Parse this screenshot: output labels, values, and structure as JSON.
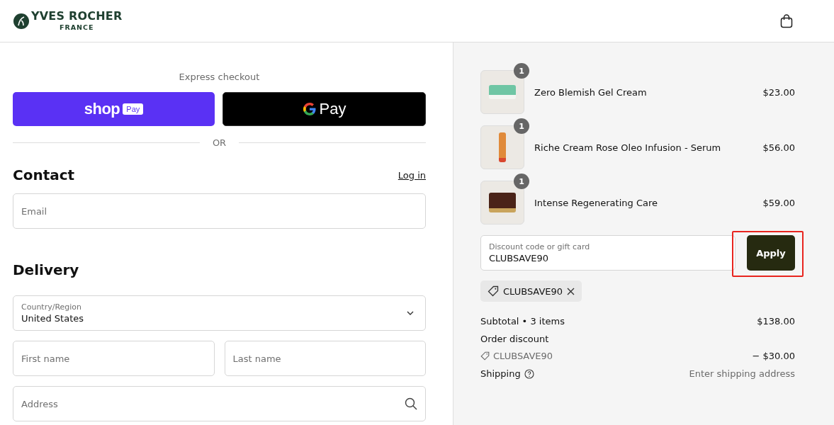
{
  "header": {
    "brand": "YVES ROCHER",
    "brand_sub": "FRANCE"
  },
  "express": {
    "title": "Express checkout",
    "shop_pay": {
      "word": "shop",
      "badge": "Pay"
    },
    "google_pay": {
      "word": "Pay"
    },
    "divider": "OR"
  },
  "contact": {
    "title": "Contact",
    "login_link": "Log in",
    "email": {
      "placeholder": "Email"
    }
  },
  "delivery": {
    "title": "Delivery",
    "country": {
      "label": "Country/Region",
      "value": "United States"
    },
    "first_name": {
      "placeholder": "First name"
    },
    "last_name": {
      "placeholder": "Last name"
    },
    "address": {
      "placeholder": "Address"
    }
  },
  "cart": {
    "items": [
      {
        "name": "Zero Blemish Gel Cream",
        "quantity": "1",
        "price": "$23.00",
        "kind": "jar"
      },
      {
        "name": "Riche Cream Rose Oleo Infusion - Serum",
        "quantity": "1",
        "price": "$56.00",
        "kind": "bottle"
      },
      {
        "name": "Intense Regenerating Care",
        "quantity": "1",
        "price": "$59.00",
        "kind": "darkjar"
      }
    ]
  },
  "discount": {
    "label": "Discount code or gift card",
    "value": "CLUBSAVE90",
    "apply": "Apply",
    "apply_highlighted": true,
    "applied_tag": "CLUBSAVE90"
  },
  "summary": {
    "subtotal_label": "Subtotal • 3 items",
    "subtotal": "$138.00",
    "discount_label": "Order discount",
    "discount_code": "CLUBSAVE90",
    "discount_amount": "− $30.00",
    "shipping_label": "Shipping",
    "shipping_value": "Enter shipping address"
  }
}
